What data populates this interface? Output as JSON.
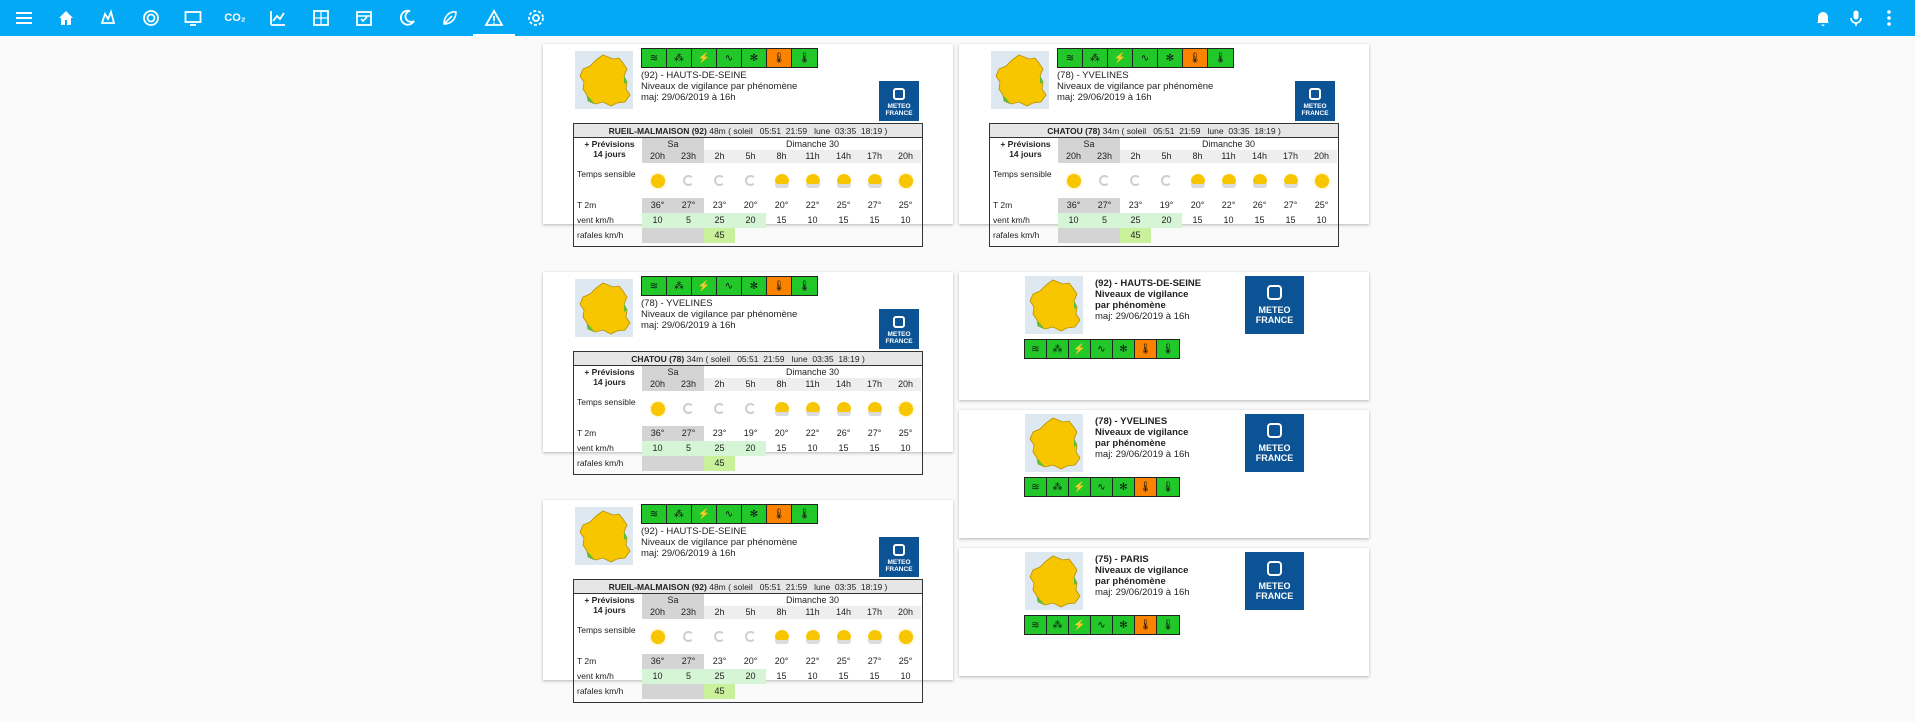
{
  "topbar": {
    "color": "#03a9f4",
    "icons": [
      "menu-icon",
      "home-icon",
      "weather-icon",
      "radar-icon",
      "tv-icon",
      "co2-icon",
      "chart-icon",
      "grid-icon",
      "calendar-icon",
      "night-icon",
      "leaf-icon",
      "warning-icon",
      "settings-icon"
    ],
    "co2_label": "CO₂",
    "right_icons": [
      "bell-icon",
      "microphone-icon",
      "more-icon"
    ]
  },
  "colors": {
    "green": "#22c72a",
    "orange": "#fb8300",
    "yellow_map": "#f7c600",
    "meteo_blue": "#0b5394"
  },
  "vigilance_levels": [
    "green",
    "green",
    "green",
    "green",
    "green",
    "orange",
    "green"
  ],
  "vigilance_icons": [
    "wind",
    "rain-flood",
    "storm",
    "flood",
    "snow-ice",
    "heatwave",
    "cold"
  ],
  "meteo_logo": {
    "line1": "METEO",
    "line2": "FRANCE"
  },
  "cards": [
    {
      "dept": "(92) - HAUTS-DE-SEINE",
      "subtitle": "Niveaux de vigilance par phénomène",
      "updated": "maj: 29/06/2019 à 16h",
      "station": "RUEIL-MALMAISON (92)",
      "alt": "48m",
      "sun": "( soleil   05:51  21:59   lune  03:35  18:19 )",
      "prev_label": "+ Prévisions",
      "prev_label2": "14 jours",
      "day1": "Sa",
      "day2": "Dimanche 30",
      "hours": [
        "20h",
        "23h",
        "2h",
        "5h",
        "8h",
        "11h",
        "14h",
        "17h",
        "20h"
      ],
      "row_sky": "Temps sensible",
      "row_t": "T 2m",
      "row_v": "vent km/h",
      "row_g": "rafales km/h",
      "temps": [
        "36°",
        "27°",
        "23°",
        "20°",
        "20°",
        "22°",
        "25°",
        "27°",
        "25°"
      ],
      "wind": [
        "10",
        "5",
        "25",
        "20",
        "15",
        "10",
        "15",
        "15",
        "10"
      ],
      "gust": [
        "",
        "",
        "45",
        "",
        "",
        "",
        "",
        "",
        ""
      ]
    },
    {
      "dept": "(78) - YVELINES",
      "subtitle": "Niveaux de vigilance par phénomène",
      "updated": "maj: 29/06/2019 à 16h",
      "station": "CHATOU (78)",
      "alt": "34m",
      "sun": "( soleil   05:51  21:59   lune  03:35  18:19 )",
      "prev_label": "+ Prévisions",
      "prev_label2": "14 jours",
      "day1": "Sa",
      "day2": "Dimanche 30",
      "hours": [
        "20h",
        "23h",
        "2h",
        "5h",
        "8h",
        "11h",
        "14h",
        "17h",
        "20h"
      ],
      "row_sky": "Temps sensible",
      "row_t": "T 2m",
      "row_v": "vent km/h",
      "row_g": "rafales km/h",
      "temps": [
        "36°",
        "27°",
        "23°",
        "19°",
        "20°",
        "22°",
        "26°",
        "27°",
        "25°"
      ],
      "wind": [
        "10",
        "5",
        "25",
        "20",
        "15",
        "10",
        "15",
        "15",
        "10"
      ],
      "gust": [
        "",
        "",
        "45",
        "",
        "",
        "",
        "",
        "",
        ""
      ]
    },
    {
      "dept": "(78) - YVELINES",
      "subtitle": "Niveaux de vigilance par phénomène",
      "updated": "maj: 29/06/2019 à 16h",
      "station": "CHATOU (78)",
      "alt": "34m",
      "sun": "( soleil   05:51  21:59   lune  03:35  18:19 )",
      "prev_label": "+ Prévisions",
      "prev_label2": "14 jours",
      "day1": "Sa",
      "day2": "Dimanche 30",
      "hours": [
        "20h",
        "23h",
        "2h",
        "5h",
        "8h",
        "11h",
        "14h",
        "17h",
        "20h"
      ],
      "row_sky": "Temps sensible",
      "row_t": "T 2m",
      "row_v": "vent km/h",
      "row_g": "rafales km/h",
      "temps": [
        "36°",
        "27°",
        "23°",
        "19°",
        "20°",
        "22°",
        "26°",
        "27°",
        "25°"
      ],
      "wind": [
        "10",
        "5",
        "25",
        "20",
        "15",
        "10",
        "15",
        "15",
        "10"
      ],
      "gust": [
        "",
        "",
        "45",
        "",
        "",
        "",
        "",
        "",
        ""
      ]
    },
    {
      "dept": "(92) - HAUTS-DE-SEINE",
      "subtitle": "Niveaux de vigilance par phénomène",
      "updated": "maj: 29/06/2019 à 16h",
      "station": "RUEIL-MALMAISON (92)",
      "alt": "48m",
      "sun": "( soleil   05:51  21:59   lune  03:35  18:19 )",
      "prev_label": "+ Prévisions",
      "prev_label2": "14 jours",
      "day1": "Sa",
      "day2": "Dimanche 30",
      "hours": [
        "20h",
        "23h",
        "2h",
        "5h",
        "8h",
        "11h",
        "14h",
        "17h",
        "20h"
      ],
      "row_sky": "Temps sensible",
      "row_t": "T 2m",
      "row_v": "vent km/h",
      "row_g": "rafales km/h",
      "temps": [
        "36°",
        "27°",
        "23°",
        "20°",
        "20°",
        "22°",
        "25°",
        "27°",
        "25°"
      ],
      "wind": [
        "10",
        "5",
        "25",
        "20",
        "15",
        "10",
        "15",
        "15",
        "10"
      ],
      "gust": [
        "",
        "",
        "45",
        "",
        "",
        "",
        "",
        "",
        ""
      ]
    }
  ],
  "compact": [
    {
      "dept": "(92) - HAUTS-DE-SEINE",
      "line1": "Niveaux de vigilance",
      "line2": "par phénomène",
      "updated": "maj: 29/06/2019 à 16h"
    },
    {
      "dept": "(78) - YVELINES",
      "line1": "Niveaux de vigilance",
      "line2": "par phénomène",
      "updated": "maj: 29/06/2019 à 16h"
    },
    {
      "dept": "(75) - PARIS",
      "line1": "Niveaux de vigilance",
      "line2": "par phénomène",
      "updated": "maj: 29/06/2019 à 16h"
    }
  ]
}
